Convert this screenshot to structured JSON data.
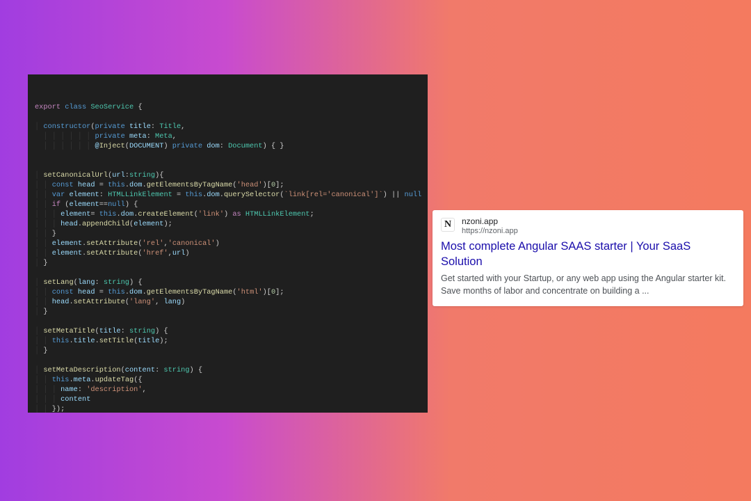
{
  "code": {
    "lines": [
      {
        "indent": 0,
        "html": "<span class='kw'>export</span> <span class='blue'>class</span> <span class='type'>SeoService</span> {"
      },
      {
        "indent": 0,
        "html": ""
      },
      {
        "indent": 1,
        "html": "<span class='blue'>constructor</span>(<span class='blue'>private</span> <span class='var'>title</span>: <span class='type'>Title</span>,"
      },
      {
        "indent": 1,
        "guide": "│ │ │ │ │ │ ",
        "html": "<span class='blue'>private</span> <span class='var'>meta</span>: <span class='type'>Meta</span>,"
      },
      {
        "indent": 1,
        "guide": "│ │ │ │ │ │ ",
        "html": "<span class='var'>@</span><span class='fn'>Inject</span>(<span class='var'>DOCUMENT</span>) <span class='blue'>private</span> <span class='var'>dom</span>: <span class='type'>Document</span>) { }"
      },
      {
        "indent": 0,
        "html": ""
      },
      {
        "indent": 0,
        "html": ""
      },
      {
        "indent": 1,
        "html": "<span class='fn'>setCanonicalUrl</span>(<span class='var'>url</span>:<span class='type'>string</span>){"
      },
      {
        "indent": 2,
        "html": "<span class='blue'>const</span> <span class='var'>head</span> = <span class='blue'>this</span>.<span class='var'>dom</span>.<span class='fn'>getElementsByTagName</span>(<span class='str'>'head'</span>)[<span class='num'>0</span>];"
      },
      {
        "indent": 2,
        "html": "<span class='blue'>var</span> <span class='var'>element</span>: <span class='type'>HTMLLinkElement</span> = <span class='blue'>this</span>.<span class='var'>dom</span>.<span class='fn'>querySelector</span>(<span class='str'>`link[rel='canonical']`</span>) || <span class='blue'>null</span>"
      },
      {
        "indent": 2,
        "html": "<span class='kw'>if</span> (<span class='var'>element</span>==<span class='blue'>null</span>) {"
      },
      {
        "indent": 3,
        "html": "<span class='var'>element</span>= <span class='blue'>this</span>.<span class='var'>dom</span>.<span class='fn'>createElement</span>(<span class='str'>'link'</span>) <span class='kw'>as</span> <span class='type'>HTMLLinkElement</span>;"
      },
      {
        "indent": 3,
        "html": "<span class='var'>head</span>.<span class='fn'>appendChild</span>(<span class='var'>element</span>);"
      },
      {
        "indent": 2,
        "html": "}"
      },
      {
        "indent": 2,
        "html": "<span class='var'>element</span>.<span class='fn'>setAttribute</span>(<span class='str'>'rel'</span>,<span class='str'>'canonical'</span>)"
      },
      {
        "indent": 2,
        "html": "<span class='var'>element</span>.<span class='fn'>setAttribute</span>(<span class='str'>'href'</span>,<span class='var'>url</span>)"
      },
      {
        "indent": 1,
        "html": "}"
      },
      {
        "indent": 0,
        "html": ""
      },
      {
        "indent": 1,
        "html": "<span class='fn'>setLang</span>(<span class='var'>lang</span>: <span class='type'>string</span>) {"
      },
      {
        "indent": 2,
        "html": "<span class='blue'>const</span> <span class='var'>head</span> = <span class='blue'>this</span>.<span class='var'>dom</span>.<span class='fn'>getElementsByTagName</span>(<span class='str'>'html'</span>)[<span class='num'>0</span>];"
      },
      {
        "indent": 2,
        "html": "<span class='var'>head</span>.<span class='fn'>setAttribute</span>(<span class='str'>'lang'</span>, <span class='var'>lang</span>)"
      },
      {
        "indent": 1,
        "html": "}"
      },
      {
        "indent": 0,
        "html": ""
      },
      {
        "indent": 1,
        "html": "<span class='fn'>setMetaTitle</span>(<span class='var'>title</span>: <span class='type'>string</span>) {"
      },
      {
        "indent": 2,
        "html": "<span class='blue'>this</span>.<span class='var'>title</span>.<span class='fn'>setTitle</span>(<span class='var'>title</span>);"
      },
      {
        "indent": 1,
        "html": "}"
      },
      {
        "indent": 0,
        "html": ""
      },
      {
        "indent": 1,
        "html": "<span class='fn'>setMetaDescription</span>(<span class='var'>content</span>: <span class='type'>string</span>) {"
      },
      {
        "indent": 2,
        "html": "<span class='blue'>this</span>.<span class='var'>meta</span>.<span class='fn'>updateTag</span>({"
      },
      {
        "indent": 3,
        "html": "<span class='var'>name</span>: <span class='str'>'description'</span>,"
      },
      {
        "indent": 3,
        "html": "<span class='var'>content</span>"
      },
      {
        "indent": 2,
        "html": "});"
      },
      {
        "indent": 1,
        "html": "}"
      },
      {
        "indent": 0,
        "html": "}"
      }
    ]
  },
  "search": {
    "favicon_letter": "N",
    "domain_name": "nzoni.app",
    "url": "https://nzoni.app",
    "title": "Most complete Angular SAAS starter | Your SaaS Solution",
    "description": "Get started with your Startup, or any web app using the Angular starter kit. Save months of labor and concentrate on building a ..."
  }
}
